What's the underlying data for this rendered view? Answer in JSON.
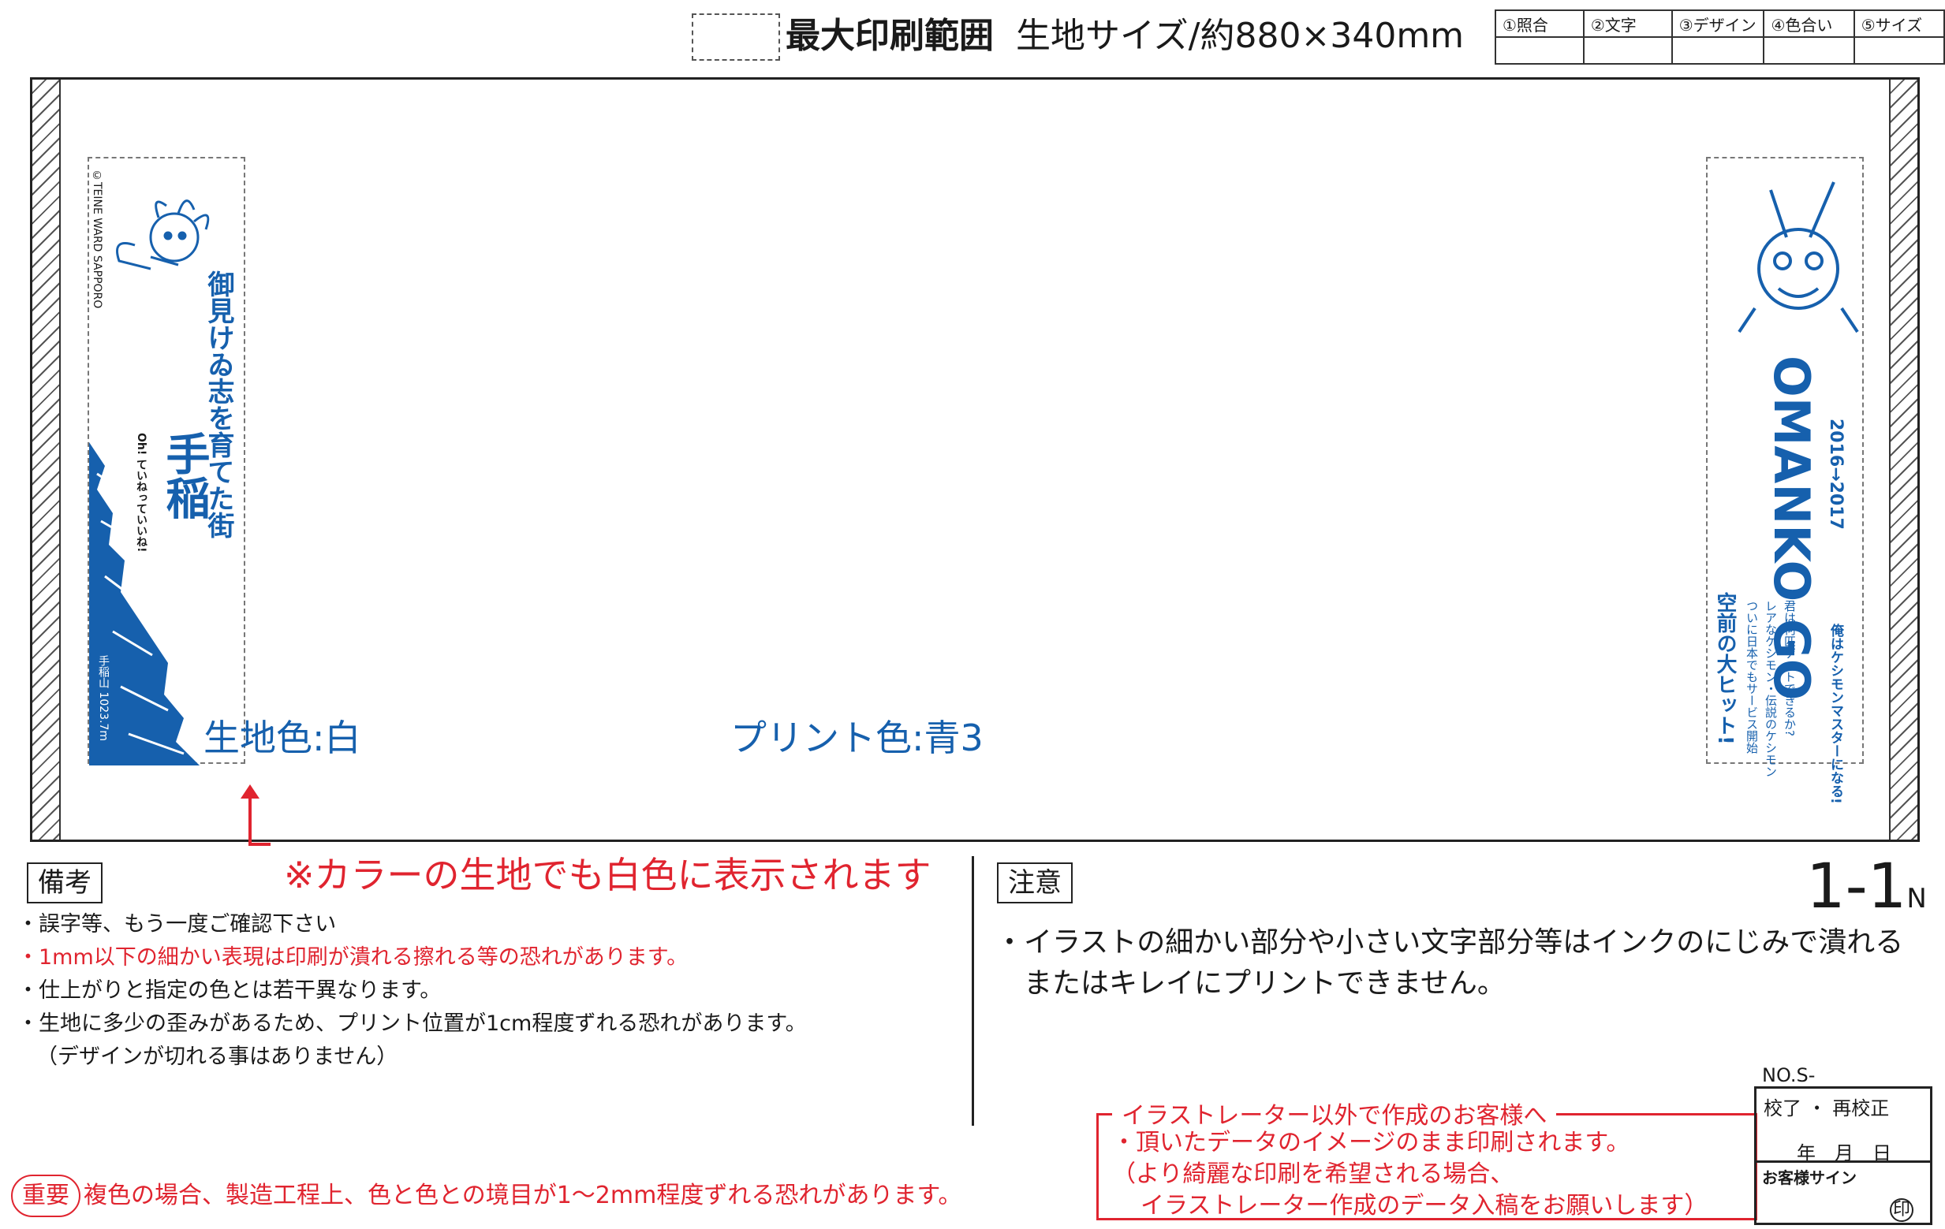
{
  "header": {
    "legend_label": "最大印刷範囲",
    "size_label": "生地サイズ/約880×340mm",
    "checklist": [
      "①照合",
      "②文字",
      "③デザイン",
      "④色合い",
      "⑤サイズ"
    ]
  },
  "design_left": {
    "copyright": "©TEINE WARD SAPPORO",
    "slogan": "御見けゐ志を育てた街",
    "title": "手稲",
    "subtitle": "Oh! ていねっていいね!",
    "mountain": "手稲山 1023.7m"
  },
  "design_right": {
    "logo": "OMANKO GO",
    "years": "2016→2017",
    "headline": "空前の大ヒット!",
    "line1": "ついに日本でもサービス開始",
    "line2": "レアなケシモン・伝説のケシモン",
    "line3": "君は何匹ゲットできるか?",
    "line4": "俺はケシモンマスターになる!"
  },
  "fabric_color": "生地色:白",
  "print_color": "プリント色:青3",
  "color_note": "※カラーの生地でも白色に表示されます",
  "remarks": {
    "label": "備考",
    "items": [
      "・誤字等、もう一度ご確認下さい",
      "・1mm以下の細かい表現は印刷が潰れる擦れる等の恐れがあります。",
      "・仕上がりと指定の色とは若干異なります。",
      "・生地に多少の歪みがあるため、プリント位置が1cm程度ずれる恐れがあります。",
      "（デザインが切れる事はありません）"
    ]
  },
  "caution": {
    "label": "注意",
    "line1": "・イラストの細かい部分や小さい文字部分等はインクのにじみで潰れる",
    "line2": "またはキレイにプリントできません。"
  },
  "page_number": "1-1",
  "page_suffix": "N",
  "important": {
    "badge": "重要",
    "text": "複色の場合、製造工程上、色と色との境目が1〜2mm程度ずれる恐れがあります。"
  },
  "illustrator_note": {
    "title": "イラストレーター以外で作成のお客様へ",
    "line1": "・頂いたデータのイメージのまま印刷されます。",
    "line2": "（より綺麗な印刷を希望される場合、",
    "line3": "イラストレーター作成のデータ入稿をお願いします）"
  },
  "proof": {
    "no": "NO.S-",
    "status": "校了 ・ 再校正",
    "date": "年　月　日",
    "sign": "お客様サイン",
    "seal": "印"
  },
  "colors": {
    "print_blue": "#1660ad",
    "warning_red": "#e0242f"
  }
}
